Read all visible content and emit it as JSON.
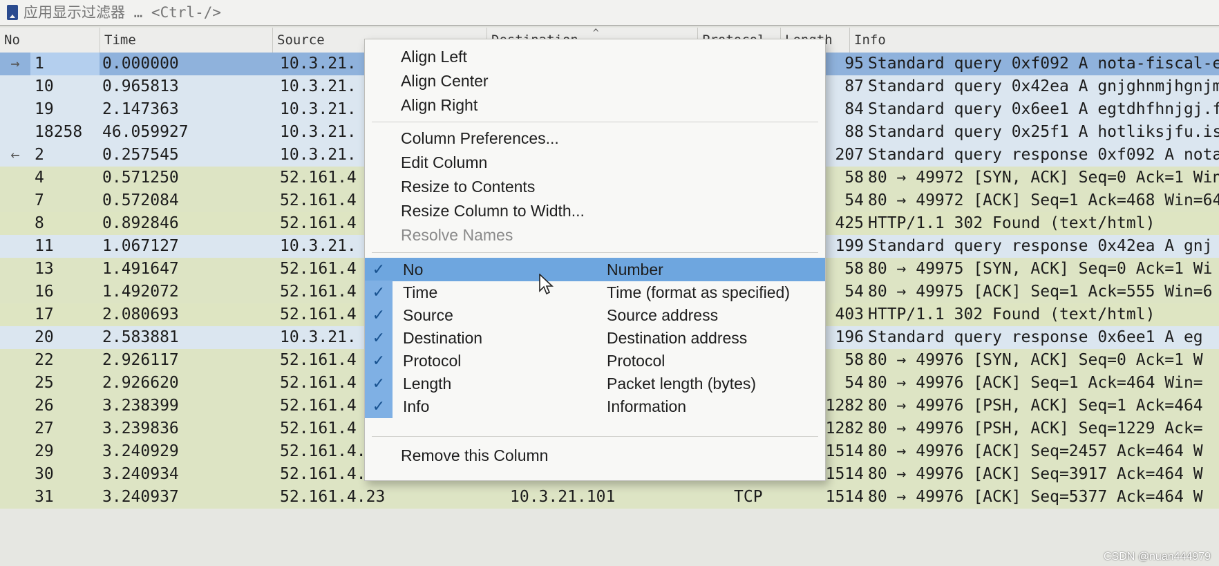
{
  "filter": {
    "placeholder": "应用显示过滤器 … <Ctrl-/>"
  },
  "columns": {
    "no": "No",
    "time": "Time",
    "source": "Source",
    "destination": "Destination",
    "protocol": "Protocol",
    "length": "Length",
    "info": "Info"
  },
  "packets": [
    {
      "marker": "→",
      "no": "1",
      "time": "0.000000",
      "source": "10.3.21.",
      "destination": "",
      "protocol": "",
      "length": "95",
      "info": "Standard query 0xf092 A nota-fiscal-e",
      "kind": "selected"
    },
    {
      "marker": "",
      "no": "10",
      "time": "0.965813",
      "source": "10.3.21.",
      "destination": "",
      "protocol": "",
      "length": "87",
      "info": "Standard query 0x42ea A gnjghnmjhgnjm",
      "kind": "dns"
    },
    {
      "marker": "",
      "no": "19",
      "time": "2.147363",
      "source": "10.3.21.",
      "destination": "",
      "protocol": "",
      "length": "84",
      "info": "Standard query 0x6ee1 A egtdhfhnjgj.f",
      "kind": "dns"
    },
    {
      "marker": "",
      "no": "18258",
      "time": "46.059927",
      "source": "10.3.21.",
      "destination": "",
      "protocol": "",
      "length": "88",
      "info": "Standard query 0x25f1 A hotliksjfu.is",
      "kind": "dns"
    },
    {
      "marker": "←",
      "no": "2",
      "time": "0.257545",
      "source": "10.3.21.",
      "destination": "",
      "protocol": "",
      "length": "207",
      "info": "Standard query response 0xf092 A nota",
      "kind": "dns"
    },
    {
      "marker": "",
      "no": "4",
      "time": "0.571250",
      "source": "52.161.4",
      "destination": "",
      "protocol": "",
      "length": "58",
      "info": "80 → 49972 [SYN, ACK] Seq=0 Ack=1 Win",
      "kind": "tcp"
    },
    {
      "marker": "",
      "no": "7",
      "time": "0.572084",
      "source": "52.161.4",
      "destination": "",
      "protocol": "",
      "length": "54",
      "info": "80 → 49972 [ACK] Seq=1 Ack=468 Win=64",
      "kind": "tcp"
    },
    {
      "marker": "",
      "no": "8",
      "time": "0.892846",
      "source": "52.161.4",
      "destination": "",
      "protocol": "",
      "length": "425",
      "info": "HTTP/1.1 302 Found  (text/html)",
      "kind": "http"
    },
    {
      "marker": "",
      "no": "11",
      "time": "1.067127",
      "source": "10.3.21.",
      "destination": "",
      "protocol": "",
      "length": "199",
      "info": "Standard query response 0x42ea A gnj",
      "kind": "dns"
    },
    {
      "marker": "",
      "no": "13",
      "time": "1.491647",
      "source": "52.161.4",
      "destination": "",
      "protocol": "",
      "length": "58",
      "info": "80 → 49975 [SYN, ACK] Seq=0 Ack=1 Wi",
      "kind": "tcp"
    },
    {
      "marker": "",
      "no": "16",
      "time": "1.492072",
      "source": "52.161.4",
      "destination": "",
      "protocol": "",
      "length": "54",
      "info": "80 → 49975 [ACK] Seq=1 Ack=555 Win=6",
      "kind": "tcp"
    },
    {
      "marker": "",
      "no": "17",
      "time": "2.080693",
      "source": "52.161.4",
      "destination": "",
      "protocol": "",
      "length": "403",
      "info": "HTTP/1.1 302 Found  (text/html)",
      "kind": "http"
    },
    {
      "marker": "",
      "no": "20",
      "time": "2.583881",
      "source": "10.3.21.",
      "destination": "",
      "protocol": "",
      "length": "196",
      "info": "Standard query response 0x6ee1 A eg",
      "kind": "dns"
    },
    {
      "marker": "",
      "no": "22",
      "time": "2.926117",
      "source": "52.161.4",
      "destination": "",
      "protocol": "",
      "length": "58",
      "info": "80 → 49976 [SYN, ACK] Seq=0 Ack=1 W",
      "kind": "tcp"
    },
    {
      "marker": "",
      "no": "25",
      "time": "2.926620",
      "source": "52.161.4",
      "destination": "",
      "protocol": "",
      "length": "54",
      "info": "80 → 49976 [ACK] Seq=1 Ack=464 Win=",
      "kind": "tcp"
    },
    {
      "marker": "",
      "no": "26",
      "time": "3.238399",
      "source": "52.161.4",
      "destination": "",
      "protocol": "",
      "length": "1282",
      "info": "80 → 49976 [PSH, ACK] Seq=1 Ack=464",
      "kind": "tcp"
    },
    {
      "marker": "",
      "no": "27",
      "time": "3.239836",
      "source": "52.161.4",
      "destination": "",
      "protocol": "",
      "length": "1282",
      "info": "80 → 49976 [PSH, ACK] Seq=1229 Ack=",
      "kind": "tcp"
    },
    {
      "marker": "",
      "no": "29",
      "time": "3.240929",
      "source": "52.161.4.23",
      "destination": "10.3.21.101",
      "protocol": "TCP",
      "length": "1514",
      "info": "80 → 49976 [ACK] Seq=2457 Ack=464 W",
      "kind": "tcp"
    },
    {
      "marker": "",
      "no": "30",
      "time": "3.240934",
      "source": "52.161.4.23",
      "destination": "10.3.21.101",
      "protocol": "TCP",
      "length": "1514",
      "info": "80 → 49976 [ACK] Seq=3917 Ack=464 W",
      "kind": "tcp"
    },
    {
      "marker": "",
      "no": "31",
      "time": "3.240937",
      "source": "52.161.4.23",
      "destination": "10.3.21.101",
      "protocol": "TCP",
      "length": "1514",
      "info": "80 → 49976 [ACK] Seq=5377 Ack=464 W",
      "kind": "tcp"
    }
  ],
  "context_menu": {
    "align_left": "Align Left",
    "align_center": "Align Center",
    "align_right": "Align Right",
    "column_preferences": "Column Preferences...",
    "edit_column": "Edit Column",
    "resize_to_contents": "Resize to Contents",
    "resize_column_to_width": "Resize Column to Width...",
    "resolve_names": "Resolve Names",
    "columns": [
      {
        "label": "No",
        "description": "Number",
        "checked": true
      },
      {
        "label": "Time",
        "description": "Time (format as specified)",
        "checked": true
      },
      {
        "label": "Source",
        "description": "Source address",
        "checked": true
      },
      {
        "label": "Destination",
        "description": "Destination address",
        "checked": true
      },
      {
        "label": "Protocol",
        "description": "Protocol",
        "checked": true
      },
      {
        "label": "Length",
        "description": "Packet length (bytes)",
        "checked": true
      },
      {
        "label": "Info",
        "description": "Information",
        "checked": true
      }
    ],
    "remove_column": "Remove this Column"
  },
  "watermark": "CSDN @nuan444979",
  "colors": {
    "dns_row": "#dbe6f0",
    "tcp_row": "#dde4c4",
    "selected_row": "#8fb2dc",
    "menu_highlight": "#6ea6df"
  }
}
